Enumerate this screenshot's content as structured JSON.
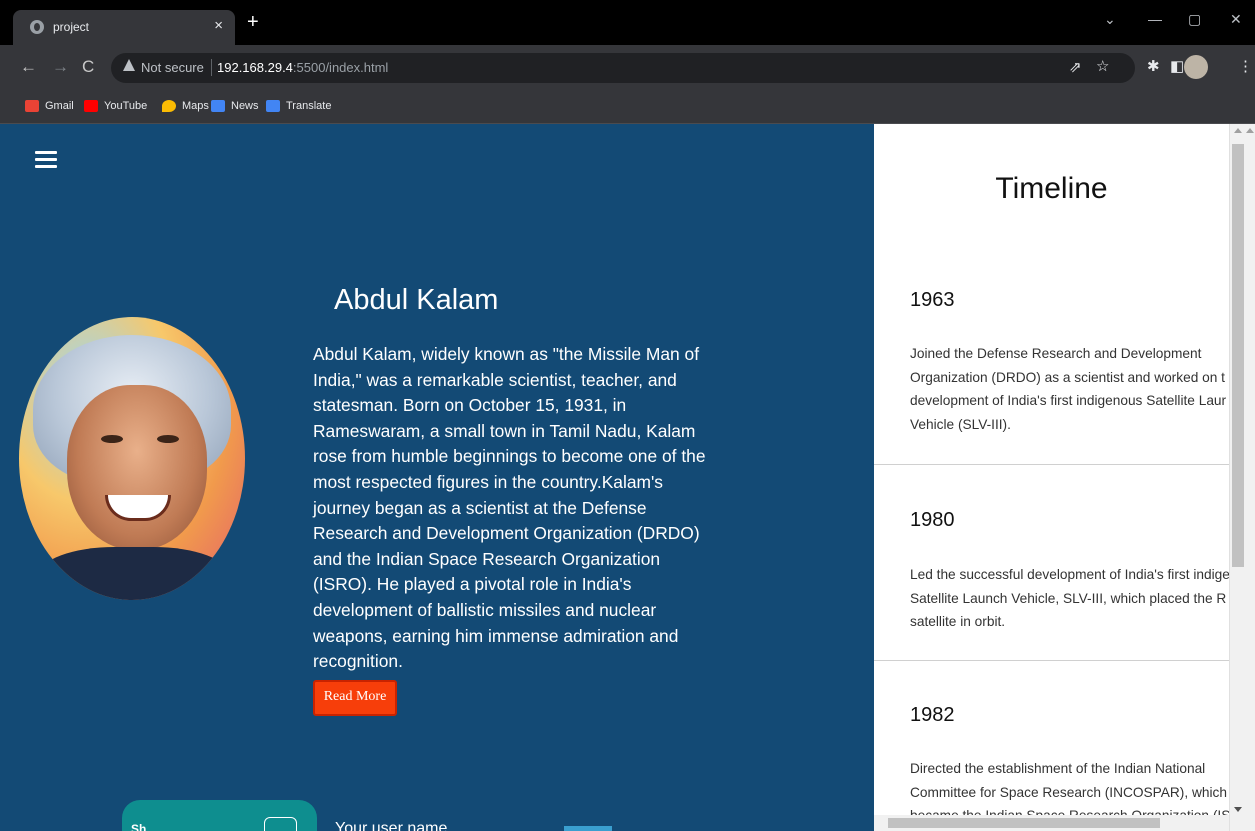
{
  "browser": {
    "tab_title": "project",
    "tab_close": "×",
    "new_tab": "+",
    "window_controls": [
      "⌄",
      "—",
      "▢",
      "✕"
    ],
    "not_secure": "Not secure",
    "url_host": "192.168.29.4",
    "url_path": ":5500/index.html",
    "bookmarks": [
      {
        "label": "Gmail",
        "color": "#ea4335"
      },
      {
        "label": "YouTube",
        "color": "#ff0000"
      },
      {
        "label": "Maps",
        "color": "#fbbc04"
      },
      {
        "label": "News",
        "color": "#4285f4"
      },
      {
        "label": "Translate",
        "color": "#4285f4"
      }
    ]
  },
  "hero": {
    "name": "Abdul Kalam",
    "bio": "Abdul Kalam, widely known as \"the Missile Man of India,\" was a remarkable scientist, teacher, and statesman. Born on October 15, 1931, in Rameswaram, a small town in Tamil Nadu, Kalam rose from humble beginnings to become one of the most respected figures in the country.Kalam's journey began as a scientist at the Defense Research and Development Organization (DRDO) and the Indian Space Research Organization (ISRO). He played a pivotal role in India's development of ballistic missiles and nuclear weapons, earning him immense admiration and recognition.",
    "read_more": "Read More",
    "bg_color": "#134a75",
    "button_color": "#f73e0a"
  },
  "bottom": {
    "share_label": "Sh...",
    "share_button": "...",
    "username_label": "Your user name"
  },
  "timeline": {
    "title": "Timeline",
    "entries": [
      {
        "year": "1963",
        "lines": [
          "Joined the Defense Research and Development",
          "Organization (DRDO) as a scientist and worked on t",
          "development of India's first indigenous Satellite Laur",
          "Vehicle (SLV-III)."
        ]
      },
      {
        "year": "1980",
        "lines": [
          "Led the successful development of India's first indige",
          "Satellite Launch Vehicle, SLV-III, which placed the R",
          "satellite in orbit."
        ]
      },
      {
        "year": "1982",
        "lines": [
          "Directed the establishment of the Indian National",
          "Committee for Space Research (INCOSPAR), which",
          "became the Indian Space Research Organization (ISR"
        ]
      }
    ]
  }
}
